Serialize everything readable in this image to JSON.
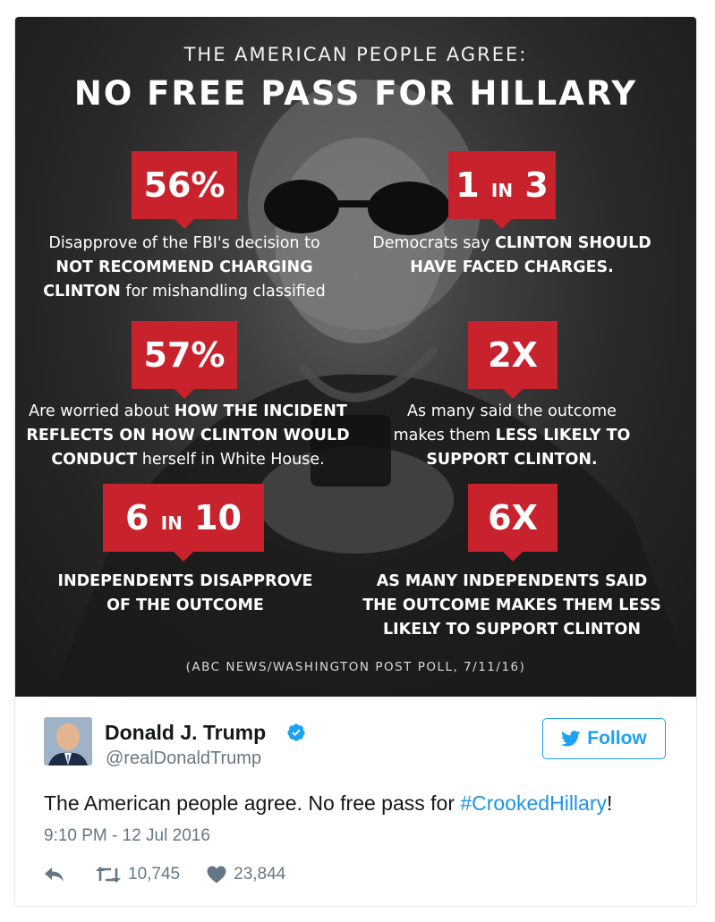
{
  "infographic": {
    "eyebrow": "THE AMERICAN PEOPLE AGREE:",
    "headline": "NO FREE PASS FOR HILLARY",
    "stats": [
      {
        "big": "56%",
        "desc_parts": [
          {
            "t": "Disapprove of the FBI's decision to",
            "b": false
          },
          {
            "t": "NOT RECOMMEND CHARGING",
            "b": true
          },
          {
            "t": "CLINTON",
            "b": true
          },
          {
            "t": " for mishandling classified",
            "b": false
          }
        ]
      },
      {
        "big_num": "1",
        "big_mid": "IN",
        "big_num2": "3",
        "desc_parts": [
          {
            "t": "Democrats say ",
            "b": false
          },
          {
            "t": "CLINTON SHOULD",
            "b": true
          },
          {
            "t": "HAVE FACED CHARGES.",
            "b": true
          }
        ]
      },
      {
        "big": "57%",
        "desc_parts": [
          {
            "t": "Are worried about ",
            "b": false
          },
          {
            "t": "HOW THE INCIDENT",
            "b": true
          },
          {
            "t": "REFLECTS ON HOW CLINTON WOULD",
            "b": true
          },
          {
            "t": "CONDUCT",
            "b": true
          },
          {
            "t": " herself in White House.",
            "b": false
          }
        ]
      },
      {
        "big": "2X",
        "desc_parts": [
          {
            "t": "As many said the outcome",
            "b": false
          },
          {
            "t": "makes them ",
            "b": false
          },
          {
            "t": "LESS LIKELY TO",
            "b": true
          },
          {
            "t": "SUPPORT CLINTON.",
            "b": true
          }
        ]
      },
      {
        "big_num": "6",
        "big_mid": "IN",
        "big_num2": "10",
        "desc_parts": [
          {
            "t": "INDEPENDENTS DISAPPROVE",
            "b": true
          },
          {
            "t": "OF THE OUTCOME",
            "b": true
          }
        ]
      },
      {
        "big": "6X",
        "desc_parts": [
          {
            "t": "AS MANY INDEPENDENTS SAID",
            "b": true
          },
          {
            "t": "THE OUTCOME MAKES THEM LESS",
            "b": true
          },
          {
            "t": "LIKELY TO SUPPORT CLINTON",
            "b": true
          }
        ]
      }
    ],
    "source": "(ABC NEWS/WASHINGTON POST POLL, 7/11/16)"
  },
  "tweet": {
    "name": "Donald J. Trump",
    "handle": "@realDonaldTrump",
    "follow_label": "Follow",
    "text_before": "The American people agree. No free pass for ",
    "hashtag": "#CrookedHillary",
    "text_after": "!",
    "timestamp": "9:10 PM - 12 Jul 2016",
    "retweets": "10,745",
    "likes": "23,844"
  },
  "colors": {
    "accent_red": "#c8222d",
    "twitter_blue": "#1da1f2",
    "hashtag_blue": "#1b95e0",
    "muted_gray": "#657786"
  },
  "icons": [
    "verified-badge-icon",
    "twitter-bird-icon",
    "reply-icon",
    "retweet-icon",
    "heart-icon"
  ]
}
